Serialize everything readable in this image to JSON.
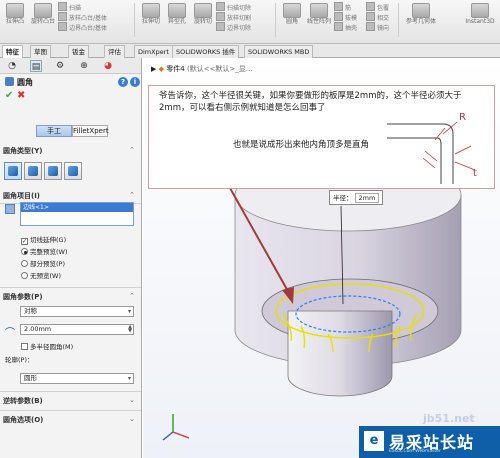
{
  "ribbon": {
    "big_buttons": [
      "拉伸凸台/基体",
      "旋转凸台/基体",
      "扫描",
      "放样凸台/基体",
      "边界凸台/基体",
      "拉伸切除",
      "异型孔向导",
      "旋转切除",
      "扫描切除",
      "放样切割",
      "边界切除",
      "圆角",
      "线性阵列",
      "筋",
      "拔模",
      "包覆",
      "抽壳",
      "相交",
      "镜向",
      "参考几何体",
      "曲线",
      "Instant3D"
    ],
    "big_visible": [
      "拉伸凸",
      "旋转凸台",
      "拉伸切",
      "异型孔",
      "旋转切",
      "圆角",
      "线性阵列",
      "参考几何体",
      "Instant3D",
      "扫描",
      "放样凸台/基体",
      "边界凸台/基体",
      "扫描切除",
      "放样切割",
      "边界切除",
      "筋",
      "拔模",
      "包覆",
      "抽壳",
      "相交",
      "镜向"
    ]
  },
  "tabs": [
    "特征",
    "草图",
    "钣金",
    "评估",
    "DimXpert",
    "SOLIDWORKS 插件",
    "SOLIDWORKS MBD"
  ],
  "left_panel": {
    "title": "圆角",
    "help_icon": "?",
    "mode_tabs": [
      "手工",
      "FilletXpert"
    ],
    "section_fillet_type": "圆角类型(Y)",
    "section_fillet_items": "圆角项目(I)",
    "item_selected": "边线<1>",
    "tangent_propagation": "切线延伸(G)",
    "preview_options": [
      "完整预览(W)",
      "部分预览(P)",
      "无预览(W)"
    ],
    "section_fillet_params": "圆角参数(P)",
    "param_type": "对称",
    "radius": "2.00mm",
    "multi_radius": "多半径圆角(M)",
    "profile_label": "轮廓(P)：",
    "profile_value": "圆形",
    "section_setback": "逆转参数(B)",
    "section_options": "圆角选项(O)"
  },
  "viewport": {
    "breadcrumb_part": "零件4",
    "breadcrumb_rest": "(默认<<默认>_显...",
    "note_line1": "爷告诉你，这个半径很关键，如果你要做形的板厚是2mm的，这个半径必须大于",
    "note_line2": "2mm，可以看右侧示例就知道是怎么回事了",
    "note_line3": "也就是说成形出来他内角顶多是直角",
    "sketch_labels": [
      "R",
      "t"
    ],
    "radius_label": "半径：",
    "radius_value": "2mm",
    "watermark": "jb51.net",
    "logo_mark": "e",
    "logo_name": "易采站长站",
    "logo_sub": "Easck.Com Webmaster"
  },
  "colors": {
    "accent": "#3a7bd5",
    "note_border": "#c8a0a0",
    "annotation_red": "#c33333",
    "fillet_yellow": "#e8e000",
    "selection_blue": "#2a7fff",
    "logo_bg": "#0e5fa8"
  }
}
